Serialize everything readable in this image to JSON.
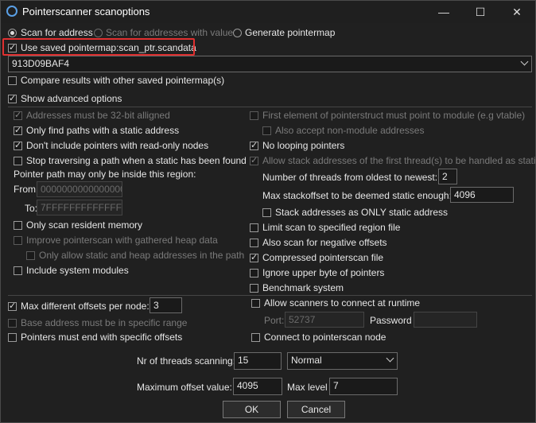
{
  "window": {
    "title": "Pointerscanner scanoptions",
    "minimize": "—",
    "maximize": "☐",
    "close": "✕"
  },
  "scan_mode": {
    "option_address": "Scan for address",
    "option_values": "Scan for addresses with value",
    "option_pointermap": "Generate pointermap",
    "selected": "Scan for address"
  },
  "use_saved": {
    "label": "Use saved pointermap:scan_ptr.scandata",
    "checked": true
  },
  "address_combo": {
    "value": "913D09BAF4"
  },
  "compare": {
    "label": "Compare results with other saved pointermap(s)",
    "checked": false
  },
  "show_advanced": {
    "label": "Show advanced options",
    "checked": true
  },
  "left": {
    "aligned": "Addresses must be 32-bit alligned",
    "static_only": "Only find paths with a static address",
    "no_readonly": "Don't include pointers with read-only nodes",
    "stop_traverse": "Stop traversing a path when a static has been found",
    "region_label": "Pointer path may only be inside this region:",
    "from_label": "From",
    "from_value": "0000000000000000",
    "to_label": "To:",
    "to_value": "7FFFFFFFFFFFFFFF",
    "resident": "Only scan resident memory",
    "heap": "Improve pointerscan with gathered heap data",
    "static_heap": "Only allow static and heap addresses in the path",
    "system_modules": "Include system modules"
  },
  "right": {
    "first_element": "First element of pointerstruct must point to module (e.g vtable)",
    "non_module": "Also accept non-module addresses",
    "no_looping": "No looping pointers",
    "allow_stack": "Allow stack addresses of the first thread(s) to be handled as static",
    "threads_label": "Number of threads from oldest to newest:",
    "threads_value": "2",
    "stackoffset_label": "Max stackoffset to be deemed static enough:",
    "stackoffset_value": "4096",
    "stack_only": "Stack addresses as ONLY static address",
    "limit_region": "Limit scan to specified region file",
    "negative": "Also scan for negative offsets",
    "compressed": "Compressed pointerscan file",
    "ignore_upper": "Ignore upper byte of pointers",
    "benchmark": "Benchmark system"
  },
  "bottom": {
    "max_offsets_label": "Max different offsets per node:",
    "max_offsets_value": "3",
    "base_range": "Base address must be in specific range",
    "must_end": "Pointers must end with specific offsets",
    "allow_scanners": "Allow scanners to connect at runtime",
    "port_label": "Port:",
    "port_value": "52737",
    "password_label": "Password",
    "password_value": "",
    "connect_node": "Connect to pointerscan node",
    "nr_threads_label": "Nr of threads scanning:",
    "nr_threads_value": "15",
    "priority_value": "Normal",
    "max_offset_label": "Maximum offset value:",
    "max_offset_value": "4095",
    "max_level_label": "Max level",
    "max_level_value": "7",
    "ok": "OK",
    "cancel": "Cancel"
  }
}
